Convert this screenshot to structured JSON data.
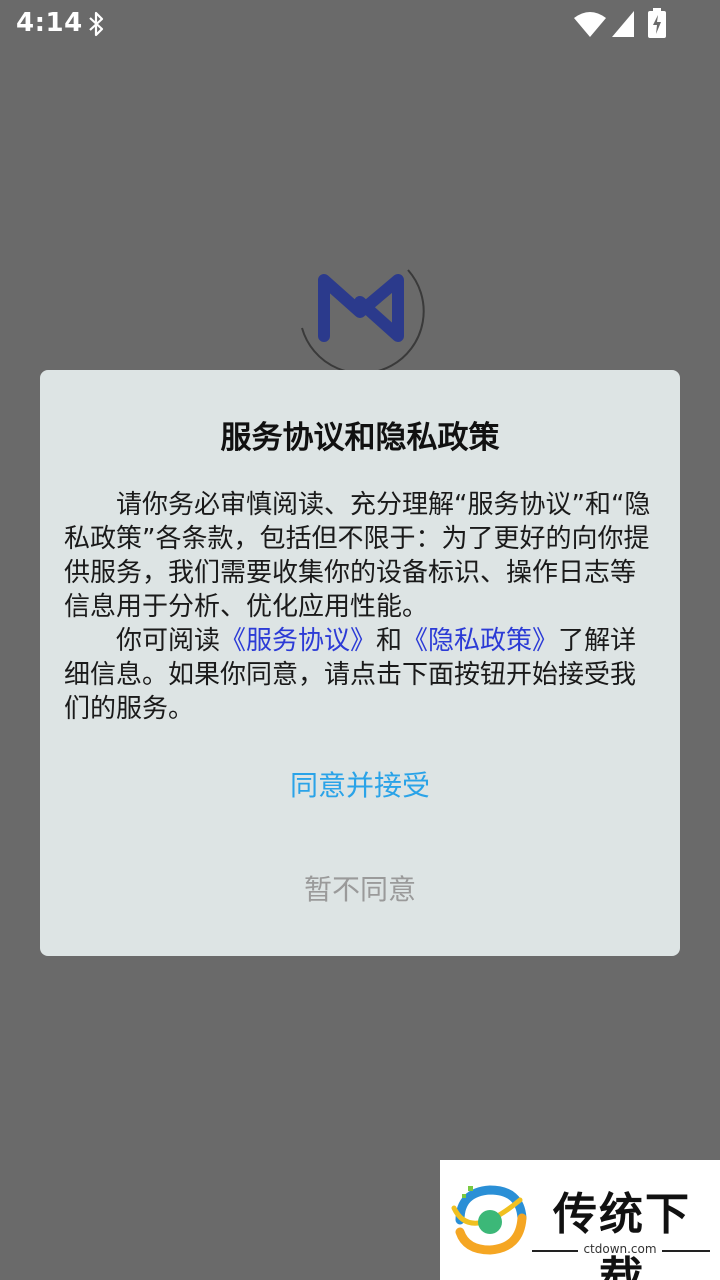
{
  "status_bar": {
    "time": "4:14",
    "icons": [
      "bluetooth-icon",
      "wifi-icon",
      "signal-icon",
      "battery-charging-icon"
    ]
  },
  "splash": {
    "logo_icon": "m-logo-icon",
    "logo_color": "#2b3a8c"
  },
  "dialog": {
    "title": "服务协议和隐私政策",
    "body_p1": "请你务必审慎阅读、充分理解“服务协议”和“隐私政策”各条款，包括但不限于：为了更好的向你提供服务，我们需要收集你的设备标识、操作日志等信息用于分析、优化应用性能。",
    "body_p2_before": "你可阅读",
    "link_service": "《服务协议》",
    "body_p2_mid": "和",
    "link_privacy": "《隐私政策》",
    "body_p2_after": "了解详细信息。如果你同意，请点击下面按钮开始接受我们的服务。",
    "agree_label": "同意并接受",
    "decline_label": "暂不同意",
    "colors": {
      "background": "#dde4e4",
      "link": "#2c3bd6",
      "agree": "#2aa3e8",
      "decline": "#9a9a9a"
    }
  },
  "watermark": {
    "title": "传统下载",
    "url": "ctdown.com"
  }
}
